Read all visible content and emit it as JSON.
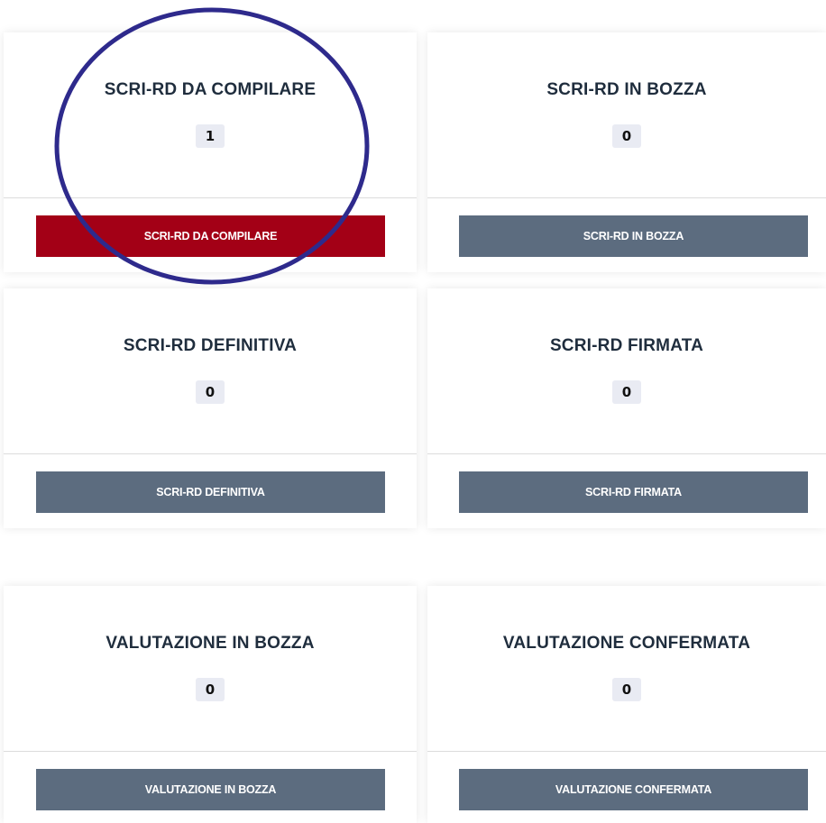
{
  "colors": {
    "primary_button": "#a30016",
    "secondary_button": "#5c6c7f",
    "highlight_circle": "#2e2a8c",
    "count_badge": "#e9ebf3",
    "title_text": "#1f2d3d"
  },
  "cards": [
    {
      "title": "SCRI-RD DA COMPILARE",
      "count": "1",
      "button_label": "SCRI-RD DA COMPILARE",
      "button_style": "primary"
    },
    {
      "title": "SCRI-RD IN BOZZA",
      "count": "0",
      "button_label": "SCRI-RD IN BOZZA",
      "button_style": "secondary"
    },
    {
      "title": "SCRI-RD DEFINITIVA",
      "count": "0",
      "button_label": "SCRI-RD DEFINITIVA",
      "button_style": "secondary"
    },
    {
      "title": "SCRI-RD FIRMATA",
      "count": "0",
      "button_label": "SCRI-RD FIRMATA",
      "button_style": "secondary"
    },
    {
      "title": "VALUTAZIONE IN BOZZA",
      "count": "0",
      "button_label": "VALUTAZIONE IN BOZZA",
      "button_style": "secondary"
    },
    {
      "title": "VALUTAZIONE CONFERMATA",
      "count": "0",
      "button_label": "VALUTAZIONE CONFERMATA",
      "button_style": "secondary"
    }
  ]
}
